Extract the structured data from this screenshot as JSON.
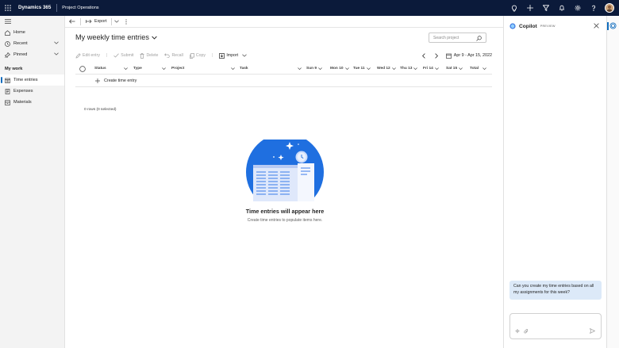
{
  "header": {
    "app_name": "Dynamics 365",
    "module_name": "Project Operations",
    "icons": [
      "lightbulb-icon",
      "plus-icon",
      "filter-icon",
      "bell-icon",
      "gear-icon",
      "help-icon",
      "avatar"
    ]
  },
  "sidebar": {
    "items": [
      {
        "label": "Home",
        "icon": "home-icon"
      },
      {
        "label": "Recent",
        "icon": "clock-icon"
      },
      {
        "label": "Pinned",
        "icon": "pin-icon"
      }
    ],
    "section_title": "My work",
    "work_items": [
      {
        "label": "Time entries",
        "icon": "calendar-icon",
        "active": true
      },
      {
        "label": "Expenses",
        "icon": "receipt-icon",
        "active": false
      },
      {
        "label": "Materials",
        "icon": "box-icon",
        "active": false
      }
    ]
  },
  "command_bar": {
    "export_label": "Export"
  },
  "page": {
    "title": "My weekly time entries",
    "search_placeholder": "Search project"
  },
  "grid_toolbar": {
    "edit_entry": "Edit entry",
    "submit": "Submit",
    "delete": "Delete",
    "recall": "Recall",
    "copy": "Copy",
    "import": "Import",
    "date_range": "Apr 9 - Apr 15, 2022"
  },
  "grid": {
    "columns": [
      "Status",
      "Type",
      "Project",
      "Task",
      "Sun 9",
      "Mon 10",
      "Tue 11",
      "Wed 12",
      "Thu 13",
      "Fri 14",
      "Sat 15",
      "Total"
    ],
    "create_label": "Create time entry",
    "row_count": "0 rows (0 selected)"
  },
  "empty_state": {
    "title": "Time entries will appear here",
    "subtitle": "Create time entries to populate items here."
  },
  "copilot": {
    "title": "Copilot",
    "badge": "PREVIEW",
    "user_message": "Can you create my time entries based on all my assignments for this week?"
  },
  "colors": {
    "topbar": "#0b1a3a",
    "accent": "#0f6cbd",
    "illustration": "#1f6fe0",
    "bubble": "#dce9f8"
  }
}
